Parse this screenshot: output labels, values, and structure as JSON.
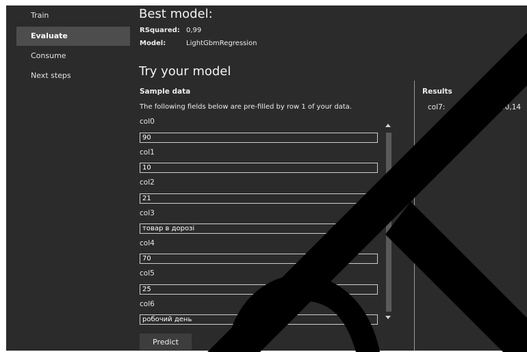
{
  "sidebar": {
    "items": [
      {
        "label": "Train",
        "active": false
      },
      {
        "label": "Evaluate",
        "active": true
      },
      {
        "label": "Consume",
        "active": false
      },
      {
        "label": "Next steps",
        "active": false
      }
    ]
  },
  "best_model": {
    "title": "Best model:",
    "metric_label": "RSquared:",
    "metric_value": "0,99",
    "model_label": "Model:",
    "model_value": "LightGbmRegression"
  },
  "try_model": {
    "title": "Try your model",
    "sample_heading": "Sample data",
    "description": "The following fields below are pre-filled by row 1 of your data.",
    "fields": [
      {
        "label": "col0",
        "value": "90"
      },
      {
        "label": "col1",
        "value": "10"
      },
      {
        "label": "col2",
        "value": "21"
      },
      {
        "label": "col3",
        "value": "товар в дорозі"
      },
      {
        "label": "col4",
        "value": "70"
      },
      {
        "label": "col5",
        "value": "25"
      },
      {
        "label": "col6",
        "value": "робочий день"
      }
    ],
    "predict_label": "Predict"
  },
  "results": {
    "heading": "Results",
    "label": "col7:",
    "value": "60,14"
  },
  "colors": {
    "background": "#2b2b2b",
    "active_nav": "#4d4d4d",
    "watermark": "#000000"
  }
}
